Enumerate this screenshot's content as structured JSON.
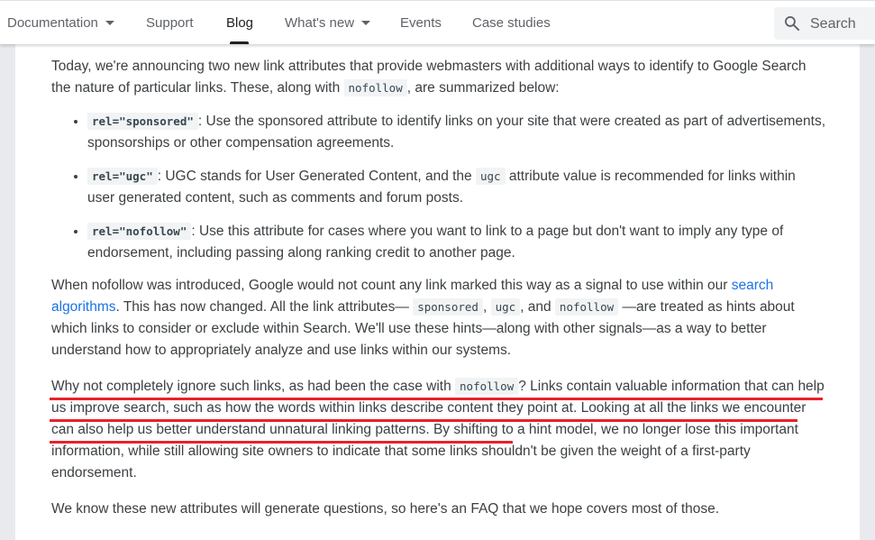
{
  "nav": {
    "items": [
      {
        "label": "Documentation",
        "has_dropdown": true,
        "active": false
      },
      {
        "label": "Support",
        "has_dropdown": false,
        "active": false
      },
      {
        "label": "Blog",
        "has_dropdown": false,
        "active": true
      },
      {
        "label": "What's new",
        "has_dropdown": true,
        "active": false
      },
      {
        "label": "Events",
        "has_dropdown": false,
        "active": false
      },
      {
        "label": "Case studies",
        "has_dropdown": false,
        "active": false
      }
    ],
    "search": {
      "icon": "search-icon",
      "placeholder": "Search"
    }
  },
  "article": {
    "intro": {
      "text1": "Today, we're announcing two new link attributes that provide webmasters with additional ways to identify to Google Search the nature of particular links. These, along with ",
      "code": "nofollow",
      "text2": ", are summarized below:"
    },
    "attributes": [
      {
        "code": "rel=\"sponsored\"",
        "text": ": Use the sponsored attribute to identify links on your site that were created as part of advertisements, sponsorships or other compensation agreements."
      },
      {
        "code": "rel=\"ugc\"",
        "text_before": ": UGC stands for User Generated Content, and the ",
        "inline_code": "ugc",
        "text_after": " attribute value is recommended for links within user generated content, such as comments and forum posts."
      },
      {
        "code": "rel=\"nofollow\"",
        "text": ": Use this attribute for cases where you want to link to a page but don't want to imply any type of endorsement, including passing along ranking credit to another page."
      }
    ],
    "para2": {
      "text1": "When nofollow was introduced, Google would not count any link marked this way as a signal to use within our ",
      "link": "search algorithms",
      "text2": ". This has now changed. All the link attributes— ",
      "code1": "sponsored",
      "sep1": ", ",
      "code2": "ugc",
      "sep2": ", and ",
      "code3": "nofollow",
      "text3": " —are treated as hints about which links to consider or exclude within Search. We'll use these hints—along with other signals—as a way to better understand how to appropriately analyze and use links within our systems."
    },
    "para3": {
      "text1": "Why not completely ignore such links, as had been the case with ",
      "code": "nofollow",
      "text2": "? Links contain valuable information that can help us improve search, such as how the words within links describe content they point at. Looking at all the links we encounter can also help us better understand unnatural linking patterns.",
      "text3": " By shifting to a hint model, we no longer lose this important information, while still allowing site owners to indicate that some links shouldn't be given the weight of a first-party endorsement.",
      "highlight_color": "#e8212b"
    },
    "para4": {
      "text": "We know these new attributes will generate questions, so here's an FAQ that we hope covers most of those."
    }
  }
}
